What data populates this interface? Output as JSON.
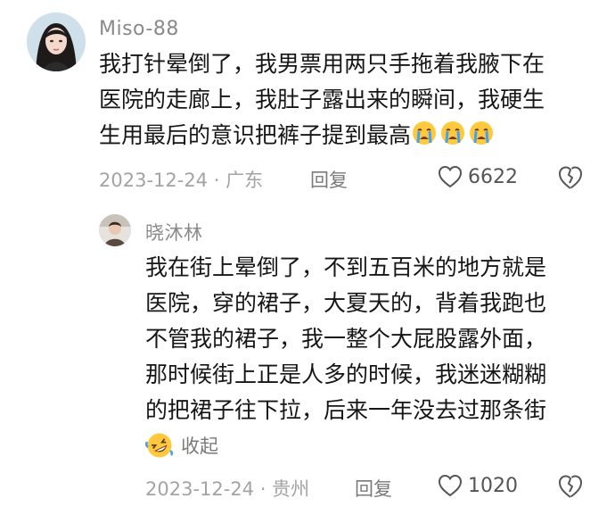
{
  "comments": [
    {
      "username": "Miso-88",
      "text_lines": [
        "我打针晕倒了，我男票用两只手拖着我腋下在",
        "医院的走廊上，我肚子露出来的瞬间，我硬生",
        "生用最后的意识把裤子提到最高"
      ],
      "trailing_emojis": [
        "crying-face",
        "crying-face",
        "crying-face"
      ],
      "date": "2023-12-24",
      "separator": "·",
      "location": "广东",
      "reply_label": "回复",
      "likes": "6622"
    }
  ],
  "reply": {
    "username": "晓沐林",
    "text_lines": [
      "我在街上晕倒了，不到五百米的地方就是",
      "医院，穿的裙子，大夏天的，背着我跑也",
      "不管我的裙子，我一整个大屁股露外面，",
      "那时候街上正是人多的时候，我迷迷糊糊",
      "的把裙子往下拉，后来一年没去过那条街"
    ],
    "collapse_emoji": "rolling-laughing-face",
    "collapse_label": "收起",
    "date": "2023-12-24",
    "separator": "·",
    "location": "贵州",
    "reply_label": "回复",
    "likes": "1020"
  },
  "colors": {
    "text": "#161616",
    "meta": "#a3a3a3",
    "username": "#8a8a8a",
    "emoji_yellow": "#ffc83d",
    "tears_blue": "#3fa3f0"
  }
}
